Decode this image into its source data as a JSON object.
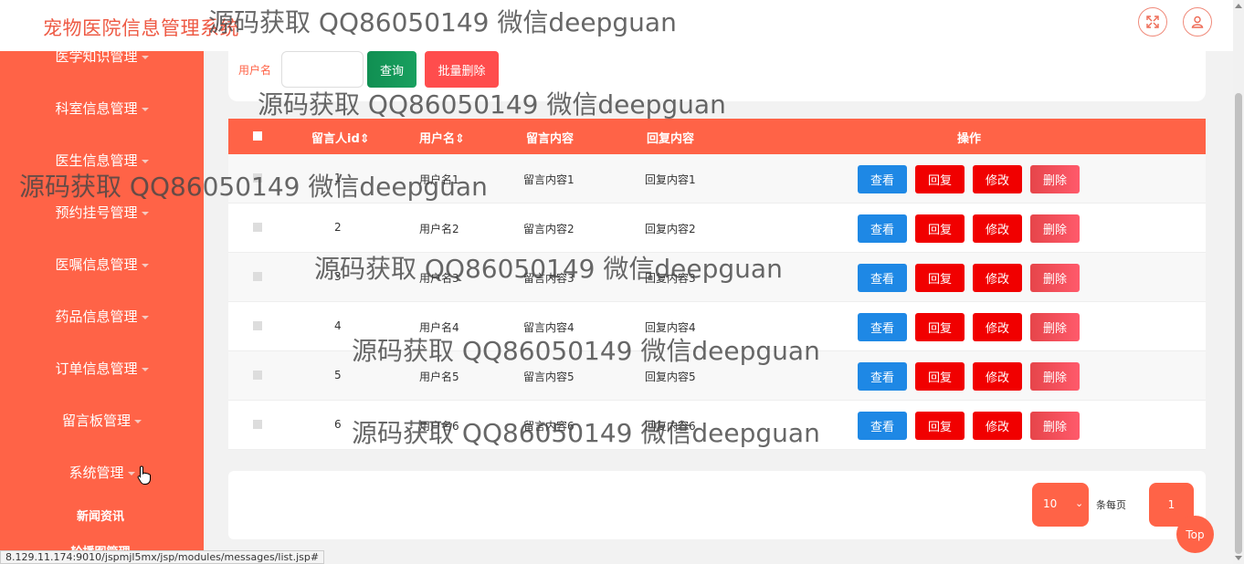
{
  "app": {
    "title": "宠物医院信息管理系统"
  },
  "header": {
    "fullscreen_icon": "fullscreen-icon",
    "user_icon": "user-icon"
  },
  "sidebar": {
    "items": [
      {
        "label": "医学知识管理"
      },
      {
        "label": "科室信息管理"
      },
      {
        "label": "医生信息管理"
      },
      {
        "label": "预约挂号管理"
      },
      {
        "label": "医嘱信息管理"
      },
      {
        "label": "药品信息管理"
      },
      {
        "label": "订单信息管理"
      },
      {
        "label": "留言板管理"
      },
      {
        "label": "系统管理"
      }
    ],
    "sub_items": [
      {
        "label": "新闻资讯"
      },
      {
        "label": "轮播图管理"
      }
    ]
  },
  "search": {
    "label": "用户名",
    "value": "",
    "query_label": "查询",
    "batch_delete_label": "批量删除"
  },
  "table": {
    "headers": {
      "select": "■",
      "id": "留言人id⇕",
      "username": "用户名⇕",
      "content": "留言内容",
      "reply": "回复内容",
      "actions": "操作"
    },
    "action_labels": {
      "view": "查看",
      "reply": "回复",
      "edit": "修改",
      "delete": "删除"
    },
    "rows": [
      {
        "id": "1",
        "username": "用户名1",
        "content": "留言内容1",
        "reply": "回复内容1"
      },
      {
        "id": "2",
        "username": "用户名2",
        "content": "留言内容2",
        "reply": "回复内容2"
      },
      {
        "id": "3",
        "username": "用户名3",
        "content": "留言内容3",
        "reply": "回复内容3"
      },
      {
        "id": "4",
        "username": "用户名4",
        "content": "留言内容4",
        "reply": "回复内容4"
      },
      {
        "id": "5",
        "username": "用户名5",
        "content": "留言内容5",
        "reply": "回复内容5"
      },
      {
        "id": "6",
        "username": "用户名6",
        "content": "留言内容6",
        "reply": "回复内容6"
      }
    ]
  },
  "pagination": {
    "page_size": "10",
    "per_page_label": "条每页",
    "current_page": "1"
  },
  "back_to_top": "Top",
  "status_url": "8.129.11.174:9010/jspmjl5mx/jsp/modules/messages/list.jsp#",
  "watermark": "源码获取 QQ86050149 微信deepguan",
  "colors": {
    "primary": "#ff6347",
    "view": "#1e88e5",
    "danger": "#f10000",
    "query": "#108f52"
  }
}
